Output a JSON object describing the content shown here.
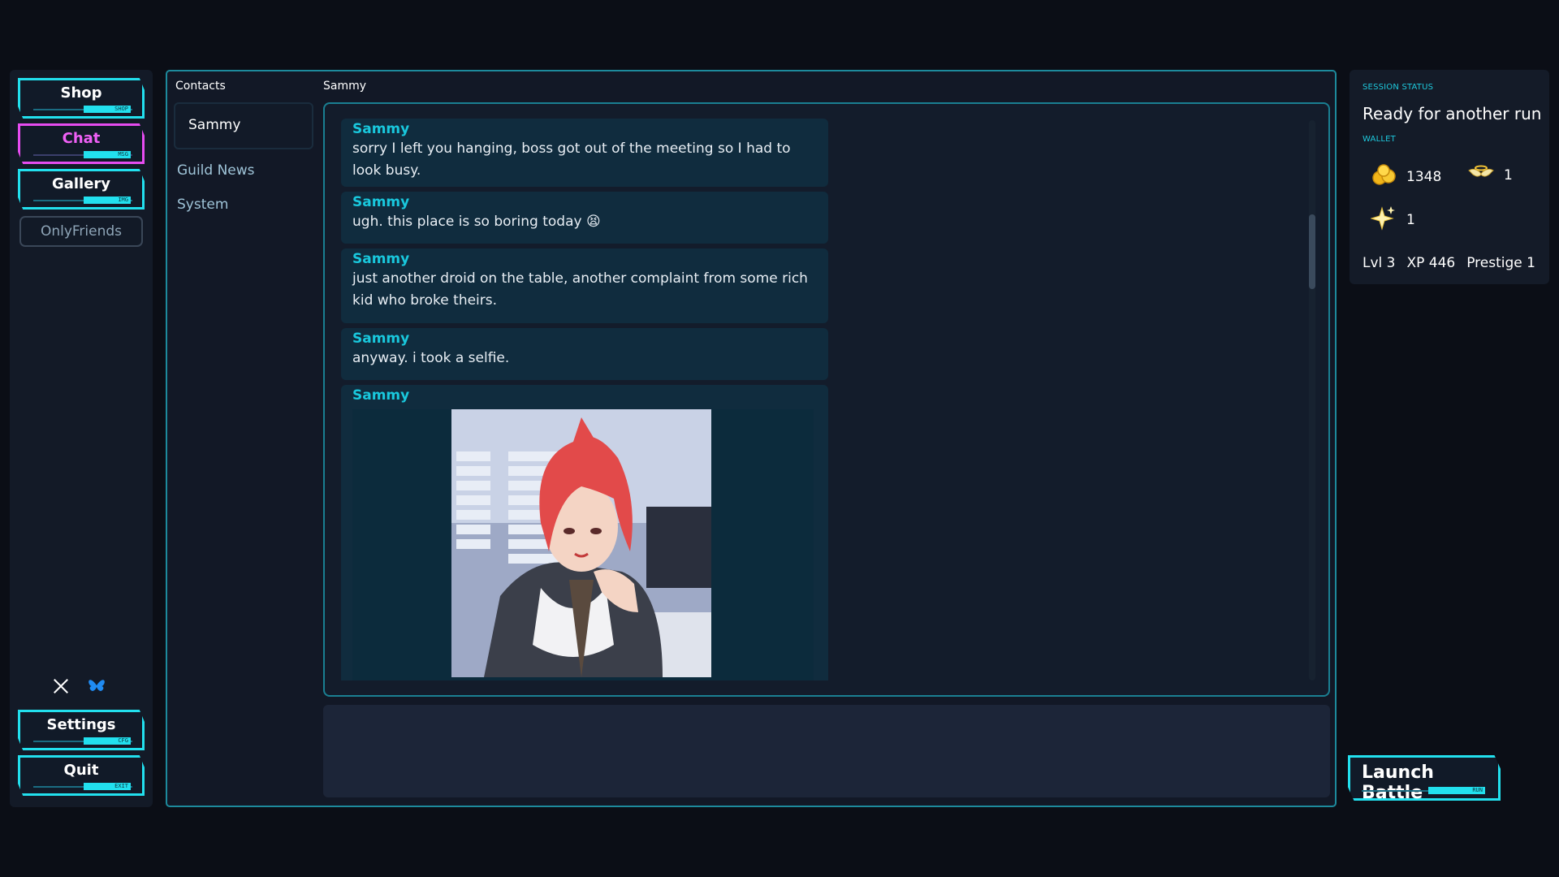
{
  "nav": {
    "items": [
      {
        "label": "Shop",
        "tag": "SHOP"
      },
      {
        "label": "Chat",
        "tag": "MSG"
      },
      {
        "label": "Gallery",
        "tag": "IMG"
      },
      {
        "label": "OnlyFriends"
      }
    ],
    "bottom": [
      {
        "label": "Settings",
        "tag": "CFG"
      },
      {
        "label": "Quit",
        "tag": "EXIT"
      }
    ]
  },
  "contacts": {
    "title": "Contacts",
    "active": "Sammy",
    "others": [
      "Guild News",
      "System"
    ]
  },
  "chat": {
    "title": "Sammy",
    "messages": [
      {
        "sender": "Sammy",
        "text": "sorry I left you hanging, boss got out of the meeting so I had to look busy."
      },
      {
        "sender": "Sammy",
        "text": "ugh. this place is so boring today 😫"
      },
      {
        "sender": "Sammy",
        "text": "just another droid on the table, another complaint from some rich kid who broke theirs."
      },
      {
        "sender": "Sammy",
        "text": "anyway. i took a selfie."
      },
      {
        "sender": "Sammy",
        "text": ""
      }
    ],
    "compose_placeholder": ""
  },
  "status": {
    "caption": "SESSION STATUS",
    "ready": "Ready for another run",
    "wallet_caption": "WALLET",
    "coins": "1348",
    "wings": "1",
    "sparkles": "1",
    "level": "Lvl 3",
    "xp": "XP 446",
    "prestige": "Prestige 1"
  },
  "launch": {
    "label": "Launch Battle",
    "tag": "RUN"
  },
  "colors": {
    "accent": "#22e0ee",
    "active": "#e64cf0",
    "sender": "#19c8dd"
  }
}
